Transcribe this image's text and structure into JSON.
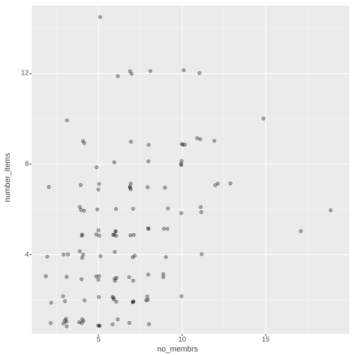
{
  "chart_data": {
    "type": "scatter",
    "title": "",
    "xlabel": "no_membrs",
    "ylabel": "number_items",
    "xlim": [
      1,
      20
    ],
    "ylim": [
      0.5,
      15
    ],
    "x_ticks_major": [
      5,
      10,
      15
    ],
    "y_ticks_major": [
      4,
      8,
      12
    ],
    "x_ticks_minor": [
      2.5,
      7.5,
      12.5,
      17.5
    ],
    "y_ticks_minor": [
      2,
      6,
      10,
      14
    ],
    "points": [
      {
        "x": 2,
        "y": 7
      },
      {
        "x": 7,
        "y": 3
      },
      {
        "x": 10,
        "y": 6
      },
      {
        "x": 7,
        "y": 4
      },
      {
        "x": 7,
        "y": 7
      },
      {
        "x": 3,
        "y": 1
      },
      {
        "x": 6,
        "y": 2
      },
      {
        "x": 12,
        "y": 7
      },
      {
        "x": 8,
        "y": 5
      },
      {
        "x": 12,
        "y": 9
      },
      {
        "x": 7,
        "y": 2
      },
      {
        "x": 6,
        "y": 3
      },
      {
        "x": 3,
        "y": 1
      },
      {
        "x": 10,
        "y": 12
      },
      {
        "x": 5,
        "y": 3
      },
      {
        "x": 4,
        "y": 2
      },
      {
        "x": 9,
        "y": 7
      },
      {
        "x": 4,
        "y": 4
      },
      {
        "x": 4,
        "y": 9
      },
      {
        "x": 5,
        "y": 14.5
      },
      {
        "x": 10,
        "y": 2
      },
      {
        "x": 11,
        "y": 4
      },
      {
        "x": 3,
        "y": 10
      },
      {
        "x": 7,
        "y": 7
      },
      {
        "x": 2,
        "y": 3
      },
      {
        "x": 17,
        "y": 5
      },
      {
        "x": 4,
        "y": 5
      },
      {
        "x": 5,
        "y": 1
      },
      {
        "x": 7,
        "y": 5
      },
      {
        "x": 8,
        "y": 1
      },
      {
        "x": 10,
        "y": 8
      },
      {
        "x": 12,
        "y": 7
      },
      {
        "x": 4,
        "y": 5
      },
      {
        "x": 7,
        "y": 2
      },
      {
        "x": 4,
        "y": 1
      },
      {
        "x": 7,
        "y": 12
      },
      {
        "x": 3,
        "y": 4
      },
      {
        "x": 10,
        "y": 8
      },
      {
        "x": 6,
        "y": 5
      },
      {
        "x": 9,
        "y": 5
      },
      {
        "x": 11,
        "y": 6
      },
      {
        "x": 4,
        "y": 3
      },
      {
        "x": 11,
        "y": 9
      },
      {
        "x": 3,
        "y": 2
      },
      {
        "x": 3,
        "y": 1
      },
      {
        "x": 4,
        "y": 4
      },
      {
        "x": 6,
        "y": 5
      },
      {
        "x": 5,
        "y": 3
      },
      {
        "x": 9,
        "y": 3
      },
      {
        "x": 7,
        "y": 5
      },
      {
        "x": 5,
        "y": 2
      },
      {
        "x": 10,
        "y": 9
      },
      {
        "x": 6,
        "y": 2
      },
      {
        "x": 6,
        "y": 8
      },
      {
        "x": 9,
        "y": 6
      },
      {
        "x": 8,
        "y": 3
      },
      {
        "x": 7,
        "y": 7
      },
      {
        "x": 13,
        "y": 7
      },
      {
        "x": 8,
        "y": 2
      },
      {
        "x": 6,
        "y": 12
      },
      {
        "x": 6,
        "y": 3
      },
      {
        "x": 4,
        "y": 4
      },
      {
        "x": 4,
        "y": 1
      },
      {
        "x": 7,
        "y": 3
      },
      {
        "x": 5,
        "y": 1
      },
      {
        "x": 6,
        "y": 6
      },
      {
        "x": 10,
        "y": 8
      },
      {
        "x": 3,
        "y": 1
      },
      {
        "x": 5,
        "y": 5
      },
      {
        "x": 4,
        "y": 6
      },
      {
        "x": 6,
        "y": 5
      },
      {
        "x": 6,
        "y": 5
      },
      {
        "x": 5,
        "y": 1
      },
      {
        "x": 15,
        "y": 10
      },
      {
        "x": 10,
        "y": 9
      },
      {
        "x": 7,
        "y": 2
      },
      {
        "x": 9,
        "y": 5
      },
      {
        "x": 6,
        "y": 3
      },
      {
        "x": 6,
        "y": 2
      },
      {
        "x": 3,
        "y": 2
      },
      {
        "x": 7,
        "y": 6
      },
      {
        "x": 4,
        "y": 6
      },
      {
        "x": 5,
        "y": 7
      },
      {
        "x": 7,
        "y": 4
      },
      {
        "x": 10,
        "y": 9
      },
      {
        "x": 4,
        "y": 1
      },
      {
        "x": 7,
        "y": 7
      },
      {
        "x": 5,
        "y": 3
      },
      {
        "x": 11,
        "y": 12
      },
      {
        "x": 8,
        "y": 8
      },
      {
        "x": 3,
        "y": 4
      },
      {
        "x": 19,
        "y": 6
      },
      {
        "x": 11,
        "y": 9
      },
      {
        "x": 9,
        "y": 3
      },
      {
        "x": 7,
        "y": 12
      },
      {
        "x": 4,
        "y": 7
      },
      {
        "x": 5,
        "y": 6
      },
      {
        "x": 4,
        "y": 1
      },
      {
        "x": 5,
        "y": 5
      },
      {
        "x": 8,
        "y": 9
      },
      {
        "x": 4,
        "y": 6
      },
      {
        "x": 8,
        "y": 2
      },
      {
        "x": 5,
        "y": 8
      },
      {
        "x": 8,
        "y": 12
      },
      {
        "x": 6,
        "y": 4
      },
      {
        "x": 6,
        "y": 1
      },
      {
        "x": 5,
        "y": 5
      },
      {
        "x": 2,
        "y": 1
      },
      {
        "x": 6,
        "y": 2
      },
      {
        "x": 2,
        "y": 4
      },
      {
        "x": 11,
        "y": 6
      },
      {
        "x": 3,
        "y": 1
      },
      {
        "x": 5,
        "y": 4
      },
      {
        "x": 8,
        "y": 5
      },
      {
        "x": 5,
        "y": 7
      },
      {
        "x": 7,
        "y": 1
      },
      {
        "x": 7,
        "y": 9
      },
      {
        "x": 8,
        "y": 7
      },
      {
        "x": 9,
        "y": 4
      },
      {
        "x": 6,
        "y": 1
      },
      {
        "x": 4,
        "y": 9
      },
      {
        "x": 8,
        "y": 2
      },
      {
        "x": 2,
        "y": 2
      },
      {
        "x": 6,
        "y": 5
      },
      {
        "x": 3,
        "y": 3
      }
    ]
  }
}
